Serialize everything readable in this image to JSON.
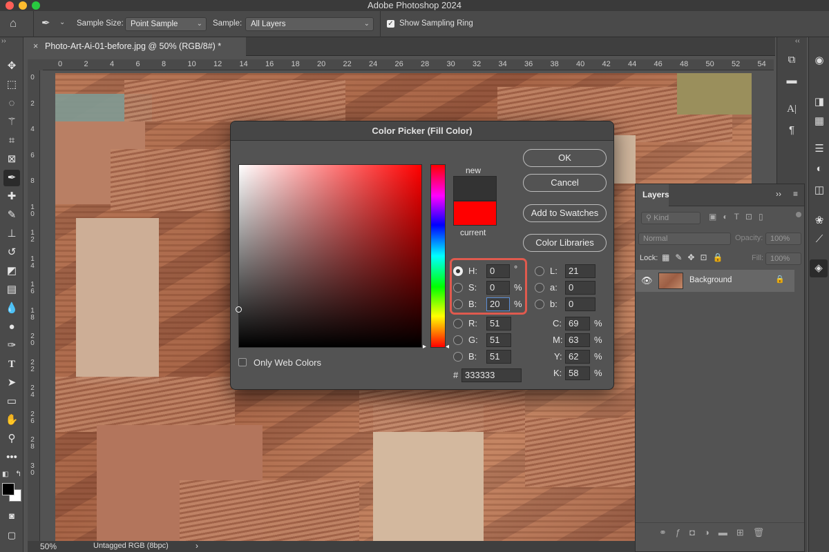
{
  "app": {
    "title": "Adobe Photoshop 2024"
  },
  "colors": {
    "accent": "#e05a4e",
    "panel": "#535353",
    "new_swatch": "#333333",
    "current_swatch": "#ff0000"
  },
  "options_bar": {
    "sample_size_label": "Sample Size:",
    "sample_size_value": "Point Sample",
    "sample_label": "Sample:",
    "sample_value": "All Layers",
    "show_sampling_ring_label": "Show Sampling Ring",
    "show_sampling_ring_checked": true
  },
  "document": {
    "tab_title": "Photo-Art-Ai-01-before.jpg @ 50% (RGB/8#) *",
    "close": "×"
  },
  "ruler": {
    "top": [
      "0",
      "2",
      "4",
      "6",
      "8",
      "10",
      "12",
      "14",
      "16",
      "18",
      "20",
      "22",
      "24",
      "26",
      "28",
      "30",
      "32",
      "34",
      "36",
      "38",
      "40",
      "42",
      "44",
      "46",
      "48",
      "50",
      "52",
      "54"
    ],
    "left": [
      "0",
      "2",
      "4",
      "6",
      "8",
      "1\n0",
      "1\n2",
      "1\n4",
      "1\n6",
      "1\n8",
      "2\n0",
      "2\n2",
      "2\n4",
      "2\n6",
      "2\n8",
      "3\n0"
    ]
  },
  "status": {
    "zoom": "50%",
    "profile": "Untagged RGB (8bpc)",
    "arrow": "›"
  },
  "layers_panel": {
    "tab": "Layers",
    "kind_placeholder": "Kind",
    "blend_mode": "Normal",
    "opacity_label": "Opacity:",
    "opacity_value": "100%",
    "lock_label": "Lock:",
    "fill_label": "Fill:",
    "fill_value": "100%",
    "layers": [
      {
        "name": "Background",
        "locked": true,
        "visible": true
      }
    ]
  },
  "color_picker": {
    "title": "Color Picker (Fill Color)",
    "new_label": "new",
    "current_label": "current",
    "buttons": {
      "ok": "OK",
      "cancel": "Cancel",
      "add_to_swatches": "Add to Swatches",
      "color_libraries": "Color Libraries"
    },
    "only_web_colors_label": "Only Web Colors",
    "only_web_colors_checked": false,
    "fields": {
      "H": {
        "label": "H:",
        "value": "0",
        "unit": "°"
      },
      "S": {
        "label": "S:",
        "value": "0",
        "unit": "%"
      },
      "Bv": {
        "label": "B:",
        "value": "20",
        "unit": "%"
      },
      "R": {
        "label": "R:",
        "value": "51"
      },
      "G": {
        "label": "G:",
        "value": "51"
      },
      "Bc": {
        "label": "B:",
        "value": "51"
      },
      "L": {
        "label": "L:",
        "value": "21"
      },
      "a": {
        "label": "a:",
        "value": "0"
      },
      "b": {
        "label": "b:",
        "value": "0"
      },
      "C": {
        "label": "C:",
        "value": "69",
        "unit": "%"
      },
      "M": {
        "label": "M:",
        "value": "63",
        "unit": "%"
      },
      "Y": {
        "label": "Y:",
        "value": "62",
        "unit": "%"
      },
      "K": {
        "label": "K:",
        "value": "58",
        "unit": "%"
      }
    },
    "hex_label": "#",
    "hex_value": "333333",
    "selected_mode": "B"
  }
}
